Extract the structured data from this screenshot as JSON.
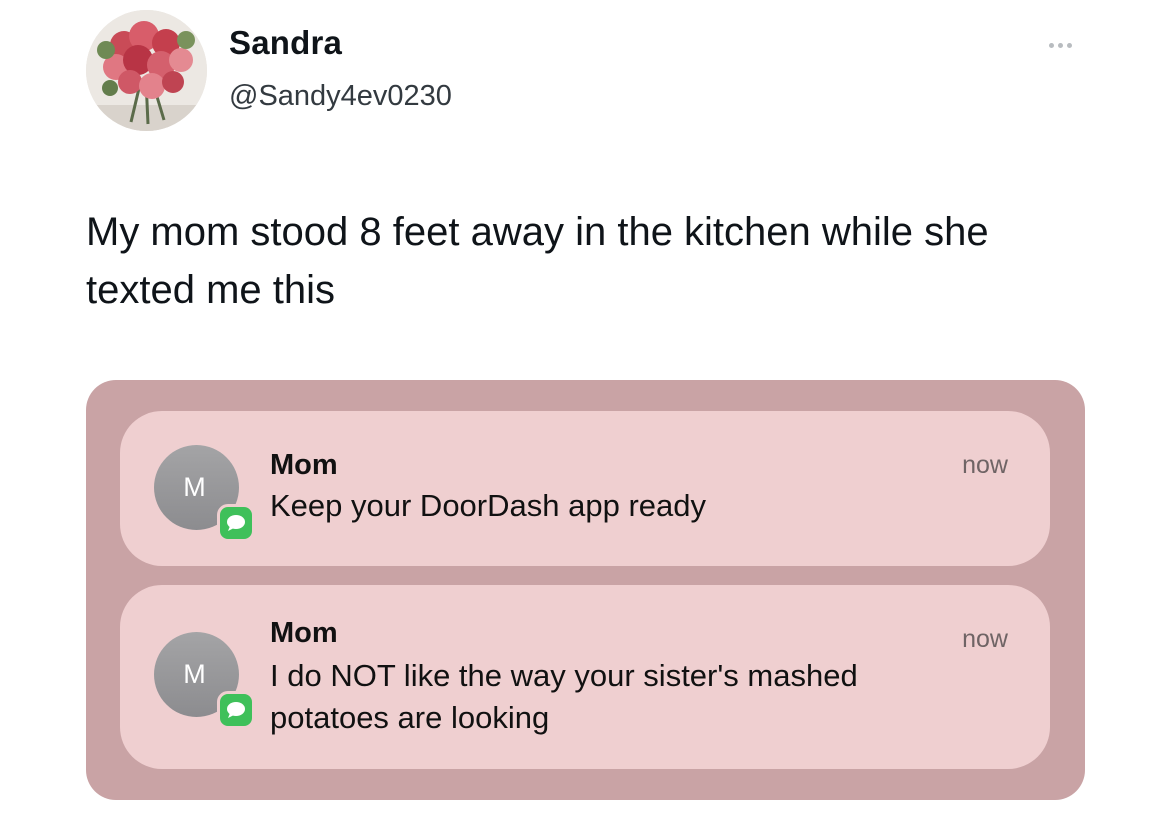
{
  "post": {
    "author": {
      "display_name": "Sandra",
      "handle": "@Sandy4ev0230",
      "avatar_icon": "flower-bouquet-avatar"
    },
    "more_icon": "ellipsis-icon",
    "text": "My mom stood 8 feet away in the kitchen while she texted me this"
  },
  "media": {
    "background_color": "#c9a3a5",
    "card_color": "#efcfd0",
    "notifications": [
      {
        "sender": "Mom",
        "avatar_initial": "M",
        "app_icon": "messages-icon",
        "message": "Keep your DoorDash app ready",
        "time": "now"
      },
      {
        "sender": "Mom",
        "avatar_initial": "M",
        "app_icon": "messages-icon",
        "message": "I do NOT like the way your sister's mashed potatoes are looking",
        "time": "now"
      }
    ]
  }
}
